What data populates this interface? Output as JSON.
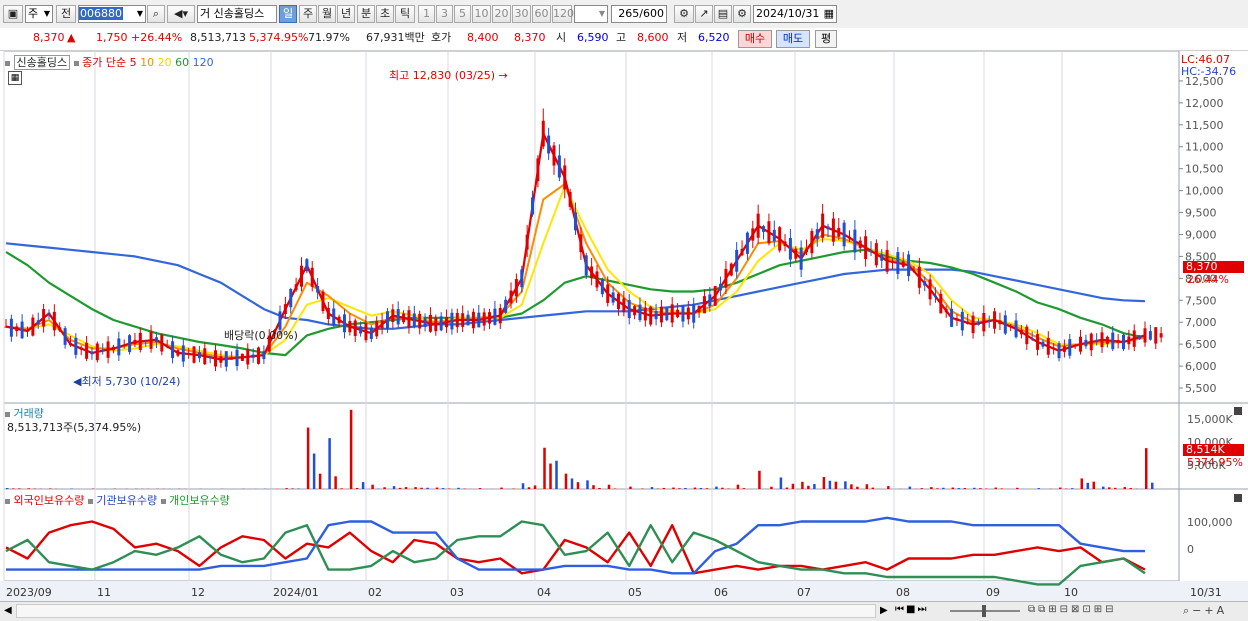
{
  "toolbar": {
    "market_type": "주",
    "prev_label": "전",
    "stock_code": "006880",
    "stock_name_prefix": "거",
    "stock_name": "신송홀딩스",
    "period_tabs": [
      "일",
      "주",
      "월",
      "년",
      "분",
      "초",
      "틱"
    ],
    "selected_period": "일",
    "interval_buttons": [
      "1",
      "3",
      "5",
      "10",
      "20",
      "30",
      "60",
      "120"
    ],
    "count": "265",
    "count_max": "/600",
    "date": "2024/10/31"
  },
  "price_row": {
    "price": "8,370",
    "change_arrow": "▲",
    "change": "1,750",
    "change_pct": "+26.44%",
    "volume": "8,513,713",
    "volume_ratio": "5,374.95%",
    "ratio2": "71.97%",
    "amount": "67,931백만",
    "bid_label": "호가",
    "ask_price": "8,400",
    "bid_price": "8,370",
    "open_label": "시",
    "open": "6,590",
    "high_label": "고",
    "high": "8,600",
    "low_label": "저",
    "low": "6,520",
    "buy_btn": "매수",
    "sell_btn": "매도",
    "eval_btn": "평"
  },
  "legend": {
    "stock": "신송홀딩스",
    "ma_title": "종가 단순",
    "ma_periods": [
      "5",
      "10",
      "20",
      "60",
      "120"
    ],
    "lc": "LC:46.07",
    "hc": "HC:-34.76"
  },
  "annotations": {
    "high": "최고 12,830 (03/25)",
    "low": "최저 5,730 (10/24)",
    "dividend": "배당락(0.00%)"
  },
  "price_axis": {
    "current_label": "8,370",
    "current_pct": "26.44%"
  },
  "volume_panel": {
    "title": "거래량",
    "value": "8,513,713주(5,374.95%)",
    "axis_labels": [
      "15,000K",
      "10,000K",
      "5,000K"
    ],
    "current_label": "8,514K",
    "current_pct": "5374.95%"
  },
  "holding_panel": {
    "legend": [
      "외국인보유수량",
      "기관보유수량",
      "개인보유수량"
    ],
    "axis_labels": [
      "100,000",
      "0"
    ]
  },
  "x_axis": {
    "labels": [
      "2023/09",
      "11",
      "12",
      "2024/01",
      "02",
      "03",
      "04",
      "05",
      "06",
      "07",
      "08",
      "09",
      "10",
      "10/31"
    ]
  },
  "colors": {
    "ma5": "#e00000",
    "ma10": "#ff8c00",
    "ma20": "#ffe600",
    "ma60": "#1f9a2e",
    "ma120": "#3366dd",
    "up": "#e00000",
    "down": "#1f4fd6"
  },
  "chart_data": [
    {
      "type": "candlestick",
      "title": "신송홀딩스",
      "x_range": [
        "2023/09",
        "2024/10/31"
      ],
      "ylim": [
        5250,
        13000
      ],
      "y_ticks": [
        5500,
        6000,
        6500,
        7000,
        7500,
        8000,
        8500,
        9000,
        9500,
        10000,
        10500,
        11000,
        11500,
        12000,
        12500
      ],
      "series": [
        {
          "name": "5",
          "values": [
            6900,
            6800,
            7200,
            6500,
            6300,
            6400,
            6550,
            6600,
            6300,
            6250,
            6150,
            6200,
            6250,
            7300,
            8300,
            7200,
            6900,
            6750,
            7150,
            7050,
            6950,
            7050,
            7050,
            7150,
            8000,
            11300,
            10300,
            8300,
            7650,
            7300,
            7150,
            7200,
            7200,
            7600,
            8400,
            9200,
            8900,
            8450,
            9200,
            9000,
            8700,
            8400,
            8300,
            7750,
            7100,
            6950,
            7050,
            6850,
            6550,
            6350,
            6500,
            6600,
            6550,
            6700
          ]
        },
        {
          "name": "10",
          "values": [
            6900,
            6850,
            7050,
            6600,
            6400,
            6400,
            6500,
            6550,
            6400,
            6300,
            6200,
            6200,
            6250,
            6900,
            7900,
            7600,
            7200,
            6950,
            7100,
            7050,
            7000,
            7050,
            7100,
            7150,
            7700,
            9800,
            10150,
            8800,
            7900,
            7450,
            7250,
            7200,
            7200,
            7400,
            8000,
            8800,
            8850,
            8550,
            9000,
            8900,
            8700,
            8450,
            8350,
            7900,
            7250,
            7000,
            7050,
            6900,
            6650,
            6450,
            6500,
            6550,
            6550,
            6650
          ]
        },
        {
          "name": "20",
          "values": [
            6900,
            6850,
            6950,
            6700,
            6450,
            6350,
            6400,
            6500,
            6450,
            6350,
            6250,
            6200,
            6250,
            6600,
            7400,
            7550,
            7350,
            7150,
            7250,
            7150,
            7000,
            7100,
            7100,
            7100,
            7400,
            8800,
            10100,
            9100,
            8200,
            7700,
            7350,
            7250,
            7200,
            7300,
            7700,
            8400,
            8800,
            8650,
            8900,
            8850,
            8700,
            8550,
            8400,
            8100,
            7500,
            7100,
            7050,
            6950,
            6750,
            6500,
            6500,
            6500,
            6550,
            6650
          ]
        },
        {
          "name": "60",
          "values": [
            8600,
            8300,
            7900,
            7600,
            7300,
            7050,
            6900,
            6750,
            6650,
            6550,
            6480,
            6400,
            6300,
            6250,
            6700,
            6850,
            6950,
            7000,
            7050,
            7100,
            7100,
            7100,
            7100,
            7100,
            7200,
            7500,
            7900,
            8050,
            7950,
            7850,
            7750,
            7700,
            7700,
            7750,
            7900,
            8100,
            8300,
            8400,
            8500,
            8600,
            8650,
            8500,
            8400,
            8350,
            8250,
            8100,
            7900,
            7700,
            7450,
            7300,
            7100,
            6950,
            6750,
            6650
          ]
        },
        {
          "name": "120",
          "values": [
            8800,
            8750,
            8700,
            8650,
            8600,
            8550,
            8500,
            8400,
            8300,
            8100,
            7900,
            7600,
            7300,
            7100,
            7050,
            6950,
            6900,
            6850,
            6850,
            6900,
            6950,
            6950,
            7000,
            7050,
            7100,
            7150,
            7200,
            7250,
            7250,
            7250,
            7300,
            7350,
            7400,
            7500,
            7600,
            7700,
            7800,
            7900,
            8000,
            8100,
            8150,
            8200,
            8200,
            8200,
            8200,
            8150,
            8050,
            7950,
            7850,
            7750,
            7650,
            7550,
            7500,
            7480
          ]
        }
      ]
    },
    {
      "type": "bar",
      "title": "거래량",
      "ylim": [
        0,
        15000
      ],
      "unit": "K",
      "values": [
        200,
        150,
        120,
        100,
        90,
        80,
        70,
        60,
        60,
        50,
        40,
        50,
        60,
        180,
        12800,
        10600,
        16500,
        900,
        600,
        400,
        300,
        250,
        200,
        300,
        1200,
        8600,
        3200,
        1800,
        900,
        500,
        400,
        300,
        300,
        500,
        900,
        3800,
        2400,
        1500,
        2500,
        1600,
        1000,
        600,
        500,
        400,
        300,
        250,
        300,
        250,
        200,
        300,
        2200,
        500,
        400,
        8514
      ]
    },
    {
      "type": "line",
      "title": "보유수량",
      "ylim": [
        -60000,
        140000
      ],
      "series": [
        {
          "name": "외국인보유수량",
          "values": [
            20000,
            -10000,
            60000,
            80000,
            90000,
            70000,
            20000,
            30000,
            10000,
            -30000,
            20000,
            50000,
            40000,
            -10000,
            30000,
            20000,
            60000,
            10000,
            -20000,
            40000,
            30000,
            -10000,
            -20000,
            -10000,
            -50000,
            -40000,
            40000,
            20000,
            -20000,
            60000,
            -30000,
            80000,
            -50000,
            -40000,
            -30000,
            -40000,
            -30000,
            -30000,
            -40000,
            -30000,
            -20000,
            -40000,
            -10000,
            -10000,
            -10000,
            0,
            0,
            10000,
            20000,
            10000,
            20000,
            -20000,
            -10000,
            -40000
          ]
        },
        {
          "name": "기관보유수량",
          "values": [
            -40000,
            -40000,
            -40000,
            -40000,
            -40000,
            -40000,
            -40000,
            -40000,
            -40000,
            -40000,
            -30000,
            -30000,
            -30000,
            -20000,
            -10000,
            80000,
            90000,
            90000,
            60000,
            60000,
            60000,
            -10000,
            -40000,
            -40000,
            -40000,
            -40000,
            -30000,
            -30000,
            -30000,
            -40000,
            -40000,
            -50000,
            -50000,
            10000,
            30000,
            80000,
            80000,
            90000,
            90000,
            90000,
            90000,
            100000,
            90000,
            90000,
            90000,
            80000,
            80000,
            80000,
            80000,
            80000,
            30000,
            20000,
            10000,
            10000
          ]
        },
        {
          "name": "개인보유수량",
          "values": [
            10000,
            40000,
            -20000,
            -30000,
            -40000,
            -20000,
            10000,
            0,
            20000,
            50000,
            0,
            -20000,
            -10000,
            60000,
            80000,
            -40000,
            -40000,
            -30000,
            10000,
            -20000,
            -10000,
            40000,
            50000,
            50000,
            90000,
            80000,
            0,
            10000,
            60000,
            -30000,
            80000,
            -20000,
            60000,
            40000,
            10000,
            -20000,
            -30000,
            -40000,
            -40000,
            -50000,
            -50000,
            -60000,
            -60000,
            -60000,
            -60000,
            -60000,
            -60000,
            -70000,
            -80000,
            -80000,
            -30000,
            -20000,
            -10000,
            -50000
          ]
        }
      ]
    }
  ]
}
